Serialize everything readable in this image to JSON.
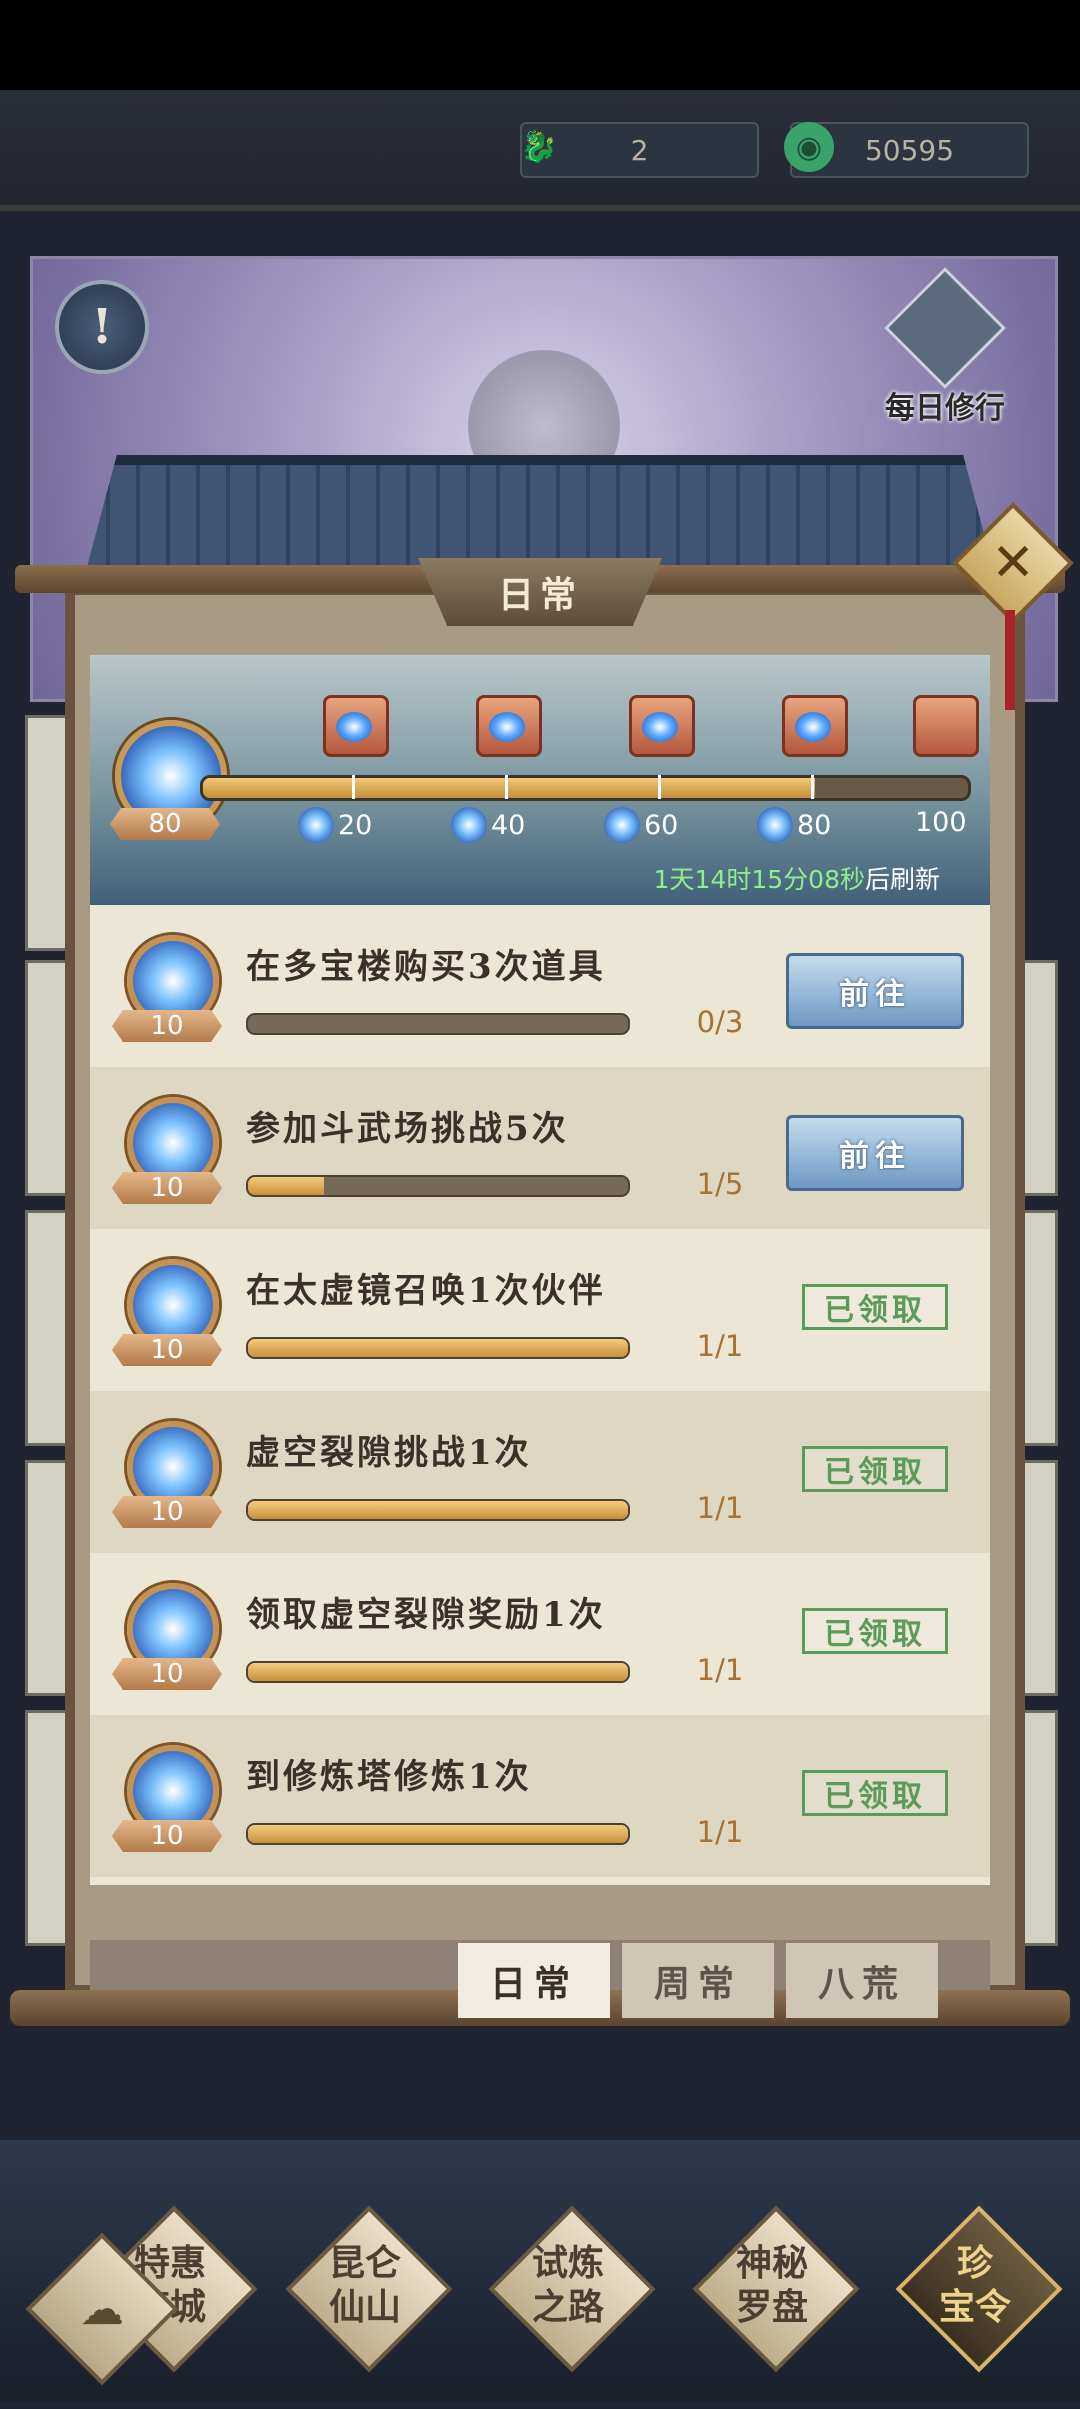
{
  "currency": [
    {
      "icon": "jade-dragon-icon",
      "value": "2"
    },
    {
      "icon": "jade-coin-icon",
      "value": "50595"
    }
  ],
  "banner": {
    "info_icon": "!",
    "daily_practice_label": "每日修行"
  },
  "panel": {
    "title": "日常",
    "close_icon": "✕"
  },
  "progress": {
    "current_points": "80",
    "max_points": 100,
    "milestones": [
      "20",
      "40",
      "60",
      "80",
      "100"
    ],
    "refresh_time": "1天14时15分08秒",
    "refresh_suffix": "后刷新"
  },
  "tasks": [
    {
      "name": "在多宝楼购买3次道具",
      "reward": "10",
      "progress": "0/3",
      "fraction": 0.0,
      "status": "前往"
    },
    {
      "name": "参加斗武场挑战5次",
      "reward": "10",
      "progress": "1/5",
      "fraction": 0.2,
      "status": "前往"
    },
    {
      "name": "在太虚镜召唤1次伙伴",
      "reward": "10",
      "progress": "1/1",
      "fraction": 1.0,
      "status": "已领取"
    },
    {
      "name": "虚空裂隙挑战1次",
      "reward": "10",
      "progress": "1/1",
      "fraction": 1.0,
      "status": "已领取"
    },
    {
      "name": "领取虚空裂隙奖励1次",
      "reward": "10",
      "progress": "1/1",
      "fraction": 1.0,
      "status": "已领取"
    },
    {
      "name": "到修炼塔修炼1次",
      "reward": "10",
      "progress": "1/1",
      "fraction": 1.0,
      "status": "已领取"
    }
  ],
  "tabs": [
    {
      "label": "日常",
      "active": true
    },
    {
      "label": "周常",
      "active": false
    },
    {
      "label": "八荒",
      "active": false
    }
  ],
  "nav": [
    {
      "line1": "特惠",
      "line2": "商城"
    },
    {
      "line1": "昆仑",
      "line2": "仙山"
    },
    {
      "line1": "试炼",
      "line2": "之路"
    },
    {
      "line1": "神秘",
      "line2": "罗盘"
    },
    {
      "line1": "珍",
      "line2": "宝令"
    }
  ],
  "colors": {
    "accent_gold": "#c9903d",
    "claimed_green": "#5b9a58",
    "go_button_blue": "#6f98c4"
  }
}
